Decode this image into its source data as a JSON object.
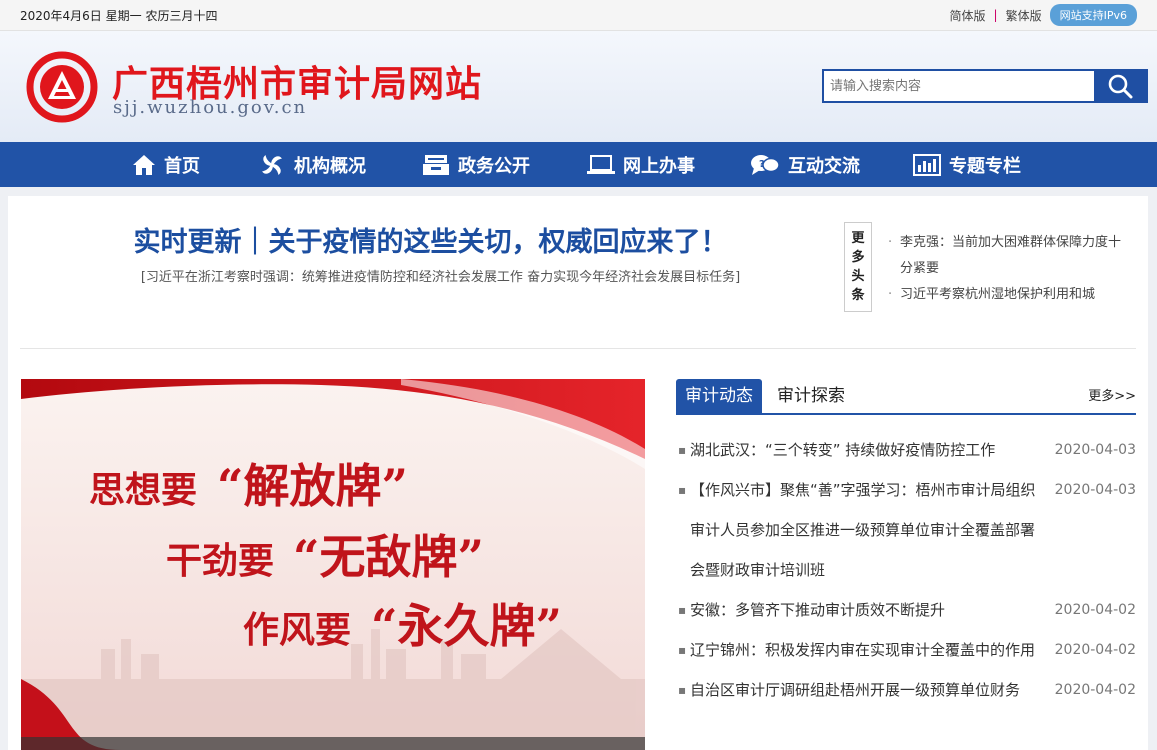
{
  "topbar": {
    "date": "2020年4月6日 星期一 农历三月十四",
    "simplified": "简体版",
    "separator": "|",
    "traditional": "繁体版",
    "ipv6": "网站支持IPv6"
  },
  "header": {
    "title": "广西梧州市审计局网站",
    "domain": "sjj.wuzhou.gov.cn",
    "search_placeholder": "请输入搜索内容"
  },
  "nav": [
    {
      "label": "首页",
      "icon": "home-icon"
    },
    {
      "label": "机构概况",
      "icon": "pinwheel-icon"
    },
    {
      "label": "政务公开",
      "icon": "inbox-icon"
    },
    {
      "label": "网上办事",
      "icon": "laptop-icon"
    },
    {
      "label": "互动交流",
      "icon": "chat-bubbles-icon"
    },
    {
      "label": "专题专栏",
      "icon": "bar-chart-icon"
    }
  ],
  "headline": {
    "title": "实时更新｜关于疫情的这些关切，权威回应来了！",
    "subtitle": "[习近平在浙江考察时强调：统筹推进疫情防控和经济社会发展工作 奋力实现今年经济社会发展目标任务]"
  },
  "more_headlines_label": [
    "更",
    "多",
    "头",
    "条"
  ],
  "top_list": [
    "李克强：当前加大困难群体保障力度十分紧要",
    "习近平考察杭州湿地保护利用和城"
  ],
  "banner": {
    "line1_pre": "思想要",
    "line1_quote": "“解放牌”",
    "line2_pre": "干劲要",
    "line2_quote": "“无敌牌”",
    "line3_pre": "作风要",
    "line3_quote": "“永久牌”"
  },
  "tabs": {
    "active": "审计动态",
    "inactive": "审计探索",
    "more": "更多>>"
  },
  "news": [
    {
      "title": "湖北武汉：“三个转变” 持续做好疫情防控工作",
      "date": "2020-04-03"
    },
    {
      "title": "【作风兴市】聚焦“善”字强学习：梧州市审计局组织审计人员参加全区推进一级预算单位审计全覆盖部署会暨财政审计培训班",
      "date": "2020-04-03"
    },
    {
      "title": "安徽：多管齐下推动审计质效不断提升",
      "date": "2020-04-02"
    },
    {
      "title": "辽宁锦州：积极发挥内审在实现审计全覆盖中的作用",
      "date": "2020-04-02"
    },
    {
      "title": "自治区审计厅调研组赴梧州开展一级预算单位财务",
      "date": "2020-04-02"
    }
  ],
  "colors": {
    "brand_red": "#e0161c",
    "nav_blue": "#2153a7",
    "headline_blue": "#1c4ea0"
  }
}
